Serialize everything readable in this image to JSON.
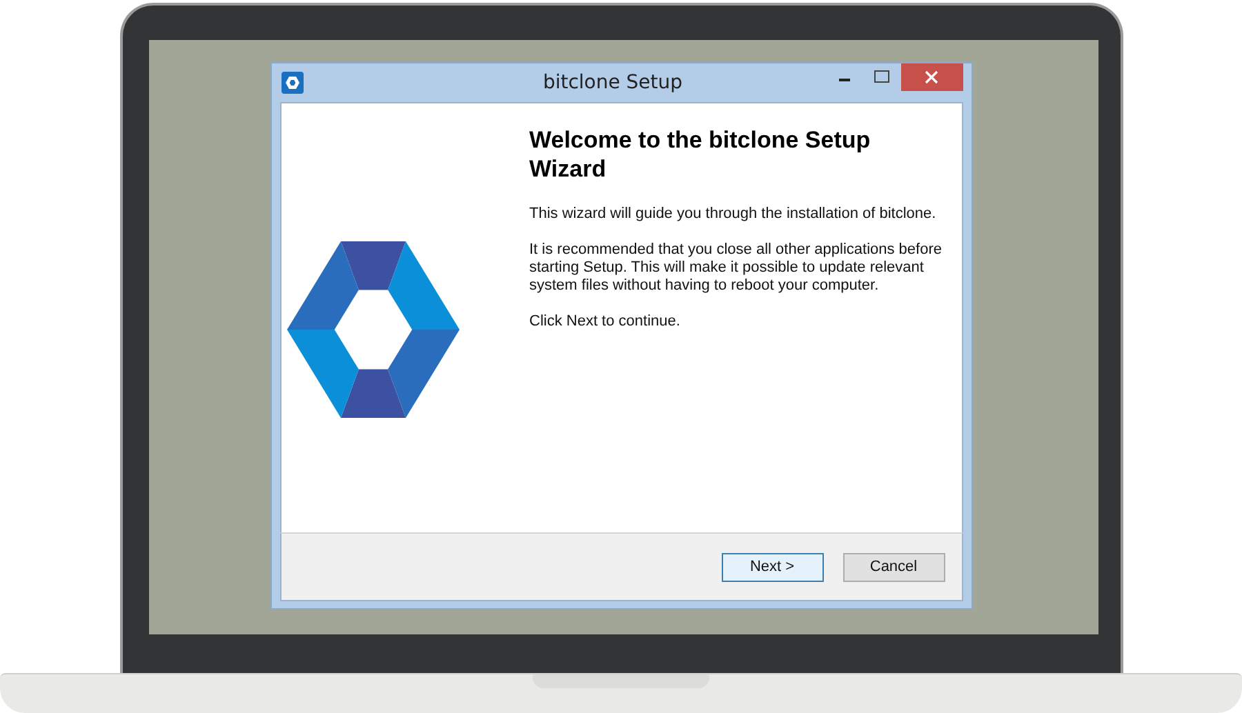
{
  "window": {
    "title": "bitclone Setup"
  },
  "heading": "Welcome to the bitclone Setup Wizard",
  "paragraphs": [
    "This wizard will guide you through the installation of bitclone.",
    "It is recommended that you close all other applications before starting Setup. This will make it possible to update relevant system files without having to reboot your computer.",
    "Click Next to continue."
  ],
  "buttons": [
    {
      "label": "Next >",
      "focused": true
    },
    {
      "label": "Cancel",
      "focused": false
    }
  ]
}
